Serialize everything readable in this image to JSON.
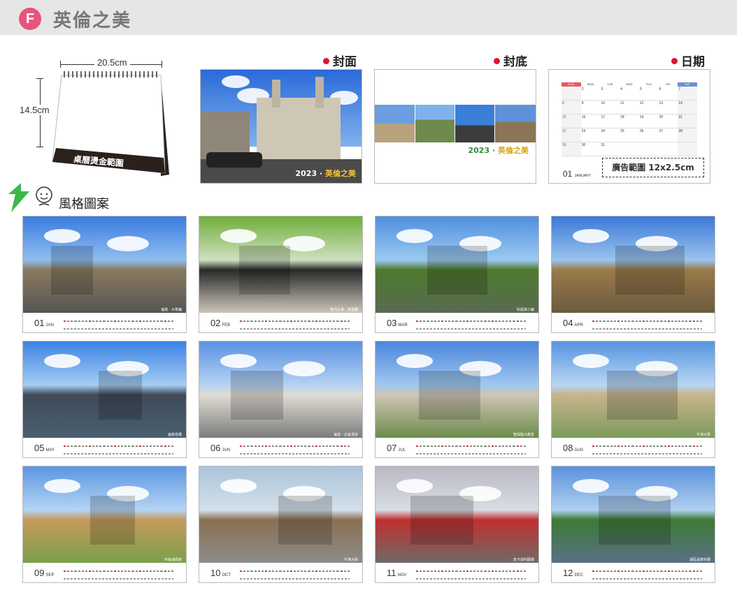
{
  "header": {
    "badge": "F",
    "title": "英倫之美"
  },
  "desk_calendar": {
    "width_label": "20.5cm",
    "height_label": "14.5cm",
    "base_label": "桌曆燙金範圍"
  },
  "sections": {
    "cover": "封面",
    "back": "封底",
    "date": "日期"
  },
  "cover": {
    "year": "2023",
    "sep": "·",
    "name": "英倫之美"
  },
  "back": {
    "year": "2023",
    "sep": "·",
    "name": "英倫之美"
  },
  "date_page": {
    "weekdays": [
      "SUN",
      "MON",
      "TUE",
      "WED",
      "THU",
      "FRI",
      "SAT"
    ],
    "rows": [
      [
        "",
        "2",
        "3",
        "4",
        "5",
        "6",
        "7"
      ],
      [
        "8",
        "9",
        "10",
        "11",
        "12",
        "13",
        "14"
      ],
      [
        "15",
        "16",
        "17",
        "18",
        "19",
        "20",
        "21"
      ],
      [
        "22",
        "23",
        "24",
        "25",
        "26",
        "27",
        "28"
      ],
      [
        "29",
        "30",
        "31",
        "",
        "",
        "",
        ""
      ]
    ],
    "month_num": "01",
    "month_name": "JANUARY",
    "ad_label": "廣告範圍 12x2.5cm"
  },
  "style_title": "風格圖案",
  "months": [
    {
      "num": "01",
      "abbr": "JAN",
      "caption": "倫敦 · 大笨鐘"
    },
    {
      "num": "02",
      "abbr": "FEB",
      "caption": "蒸汽火車 · 英格蘭"
    },
    {
      "num": "03",
      "abbr": "MAR",
      "caption": "科茲窩小鎮"
    },
    {
      "num": "04",
      "abbr": "APR",
      "caption": ""
    },
    {
      "num": "05",
      "abbr": "MAY",
      "caption": "倫敦塔橋"
    },
    {
      "num": "06",
      "abbr": "JUN",
      "caption": "倫敦 · 白金漢宮"
    },
    {
      "num": "07",
      "abbr": "JUL",
      "caption": "聖保羅大教堂"
    },
    {
      "num": "08",
      "abbr": "AUG",
      "caption": "牛津大學"
    },
    {
      "num": "09",
      "abbr": "SEP",
      "caption": "布倫海姆宮"
    },
    {
      "num": "10",
      "abbr": "OCT",
      "caption": "牛津大街"
    },
    {
      "num": "11",
      "abbr": "NOV",
      "caption": "皮卡迪利圓環"
    },
    {
      "num": "12",
      "abbr": "DEC",
      "caption": "湖區溫德米爾"
    }
  ],
  "colors": {
    "badge": "#e8547c",
    "accent_red": "#d7192a",
    "gold": "#f2c230",
    "green_text": "#2e8b3a"
  }
}
